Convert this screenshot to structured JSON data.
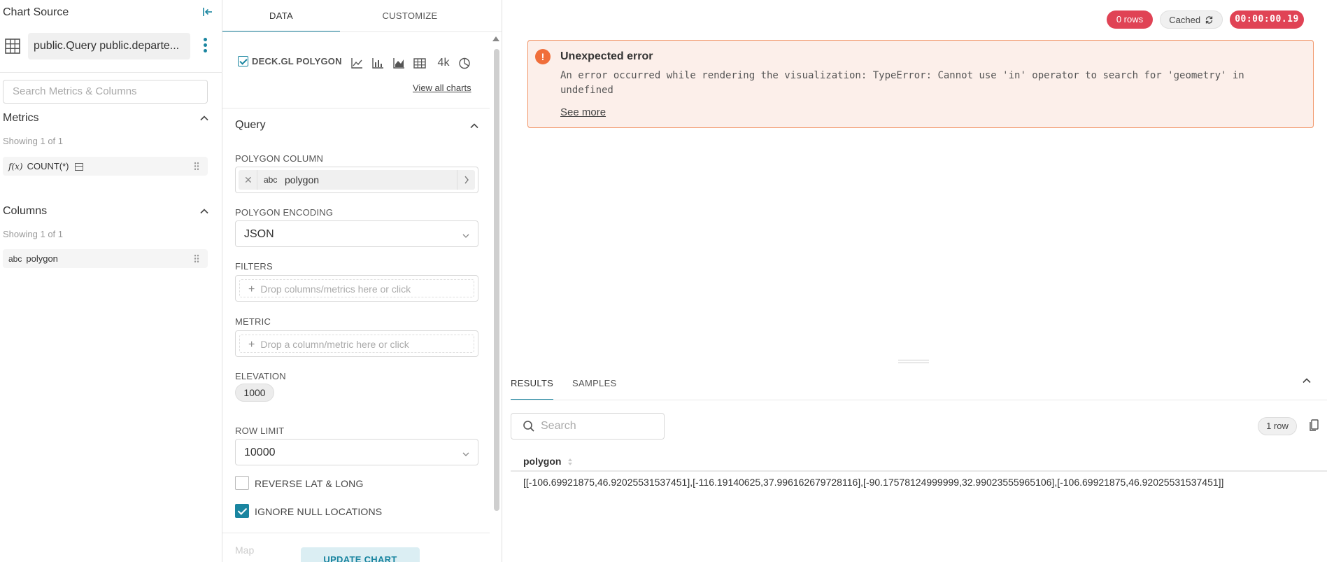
{
  "source": {
    "title": "Chart Source",
    "dataset_name": "public.Query public.departe...",
    "search_placeholder": "Search Metrics & Columns",
    "metrics": {
      "title": "Metrics",
      "showing": "Showing 1 of 1",
      "items": [
        {
          "type": "f(x)",
          "label": "COUNT(*)"
        }
      ]
    },
    "columns": {
      "title": "Columns",
      "showing": "Showing 1 of 1",
      "items": [
        {
          "type": "abc",
          "label": "polygon"
        }
      ]
    }
  },
  "controls": {
    "tabs": [
      "DATA",
      "CUSTOMIZE"
    ],
    "viz_type": "DECK.GL POLYGON",
    "viz_icons": [
      "line-chart-icon",
      "bar-chart-icon",
      "area-chart-icon",
      "table-icon",
      "big-number-icon",
      "pie-chart-icon"
    ],
    "big_number_label": "4k",
    "view_all": "View all charts",
    "query_title": "Query",
    "polygon_column": {
      "label": "POLYGON COLUMN",
      "type": "abc",
      "value": "polygon"
    },
    "polygon_encoding": {
      "label": "POLYGON ENCODING",
      "value": "JSON"
    },
    "filters": {
      "label": "FILTERS",
      "placeholder": "Drop columns/metrics here or click"
    },
    "metric": {
      "label": "METRIC",
      "placeholder": "Drop a column/metric here or click"
    },
    "elevation": {
      "label": "ELEVATION",
      "value": "1000"
    },
    "row_limit": {
      "label": "ROW LIMIT",
      "value": "10000"
    },
    "reverse_lat_long": {
      "label": "REVERSE LAT & LONG",
      "checked": false
    },
    "ignore_null": {
      "label": "IGNORE NULL LOCATIONS",
      "checked": true
    },
    "partial_label": "Map",
    "update_button": "UPDATE CHART"
  },
  "status": {
    "rows": "0 rows",
    "cached": "Cached",
    "timer": "00:00:00.19"
  },
  "error": {
    "title": "Unexpected error",
    "message": "An error occurred while rendering the visualization: TypeError: Cannot use 'in' operator to search for 'geometry' in undefined",
    "see_more": "See more"
  },
  "results": {
    "tabs": [
      "RESULTS",
      "SAMPLES"
    ],
    "search_placeholder": "Search",
    "row_count": "1 row",
    "columns": [
      "polygon"
    ],
    "rows": [
      [
        "[[-106.69921875,46.92025531537451],[-116.19140625,37.996162679728116],[-90.17578124999999,32.99023555965106],[-106.69921875,46.92025531537451]]"
      ]
    ]
  },
  "colors": {
    "accent": "#1a85a0",
    "error_red": "#e04355",
    "error_bg": "#fcefea",
    "error_border": "#f19365"
  }
}
